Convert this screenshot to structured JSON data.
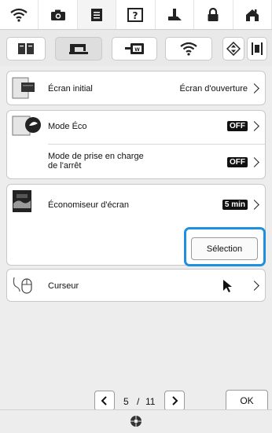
{
  "top_tabs": [
    {
      "icon": "wifi-icon"
    },
    {
      "icon": "camera-icon"
    },
    {
      "icon": "document-icon"
    },
    {
      "icon": "help-icon"
    },
    {
      "icon": "presser-foot-icon"
    },
    {
      "icon": "lock-icon"
    },
    {
      "icon": "home-icon"
    }
  ],
  "categories": [
    {
      "icon": "book-icon"
    },
    {
      "icon": "sewing-machine-icon"
    },
    {
      "icon": "embroidery-icon"
    },
    {
      "icon": "wifi-icon"
    },
    {
      "icon": "diamond-arrows-icon"
    },
    {
      "icon": "frame-icon"
    }
  ],
  "settings": {
    "ecran_initial": {
      "label": "Écran initial",
      "value": "Écran d'ouverture"
    },
    "mode_eco": {
      "label": "Mode Éco",
      "value": "OFF"
    },
    "mode_arret": {
      "label_line1": "Mode de prise en charge",
      "label_line2": "de l'arrêt",
      "value": "OFF"
    },
    "economiseur": {
      "label": "Économiseur d'écran",
      "value": "5 min"
    },
    "selection_button": "Sélection",
    "curseur": {
      "label": "Curseur"
    }
  },
  "pagination": {
    "current": "5",
    "separator": "/",
    "total": "11"
  },
  "ok_button": "OK",
  "colors": {
    "highlight": "#1f8fe0"
  }
}
